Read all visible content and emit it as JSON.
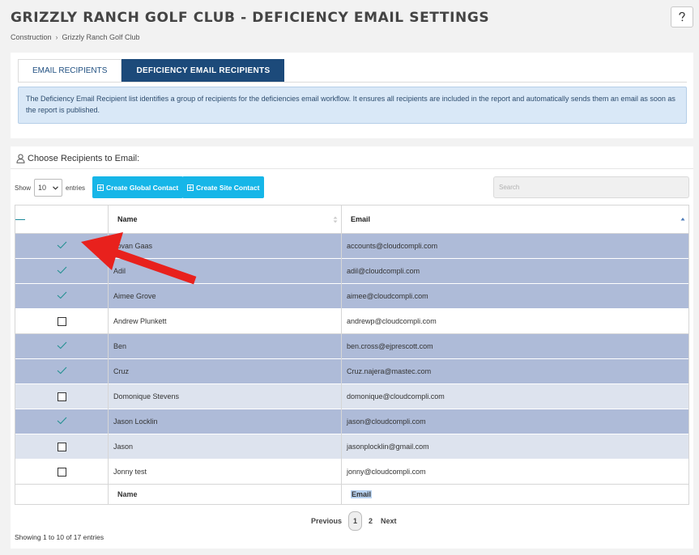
{
  "header": {
    "title": "GRIZZLY RANCH GOLF CLUB - DEFICIENCY EMAIL SETTINGS",
    "breadcrumb": [
      "Construction",
      "Grizzly Ranch Golf Club"
    ],
    "help_icon": "question-icon"
  },
  "tabs": [
    {
      "label": "EMAIL RECIPIENTS",
      "active": false
    },
    {
      "label": "DEFICIENCY EMAIL RECIPIENTS",
      "active": true
    }
  ],
  "info_text": "The Deficiency Email Recipient list identifies a group of recipients for the deficiencies email workflow. It ensures all recipients are included in the report and automatically sends them an email as soon as the report is published.",
  "section": {
    "title": "Choose Recipients to Email:",
    "show_label": "Show",
    "entries_label": "entries",
    "page_length": "10",
    "create_global": "Create Global Contact",
    "create_site": "Create Site Contact",
    "search_placeholder": "Search"
  },
  "table": {
    "headers": {
      "name": "Name",
      "email": "Email"
    },
    "footers": {
      "name": "Name",
      "email": "Email"
    },
    "rows": [
      {
        "name": "Tovan Gaas",
        "email": "accounts@cloudcompli.com",
        "selected": true
      },
      {
        "name": "Adil",
        "email": "adil@cloudcompli.com",
        "selected": true
      },
      {
        "name": "Aimee Grove",
        "email": "aimee@cloudcompli.com",
        "selected": true
      },
      {
        "name": "Andrew Plunkett",
        "email": "andrewp@cloudcompli.com",
        "selected": false
      },
      {
        "name": "Ben",
        "email": "ben.cross@ejprescott.com",
        "selected": true
      },
      {
        "name": "Cruz",
        "email": "Cruz.najera@mastec.com",
        "selected": true
      },
      {
        "name": "Domonique Stevens",
        "email": "domonique@cloudcompli.com",
        "selected": false
      },
      {
        "name": "Jason Locklin",
        "email": "jason@cloudcompli.com",
        "selected": true
      },
      {
        "name": "Jason",
        "email": "jasonplocklin@gmail.com",
        "selected": false
      },
      {
        "name": "Jonny test",
        "email": "jonny@cloudcompli.com",
        "selected": false
      }
    ]
  },
  "pagination": {
    "previous": "Previous",
    "pages": [
      "1",
      "2"
    ],
    "current": "1",
    "next": "Next"
  },
  "footer_info": "Showing 1 to 10 of 17 entries",
  "colors": {
    "accent": "#1c4a7a",
    "button": "#16b6e8",
    "selected_row": "#aebbd8",
    "arrow": "#e8211d"
  }
}
